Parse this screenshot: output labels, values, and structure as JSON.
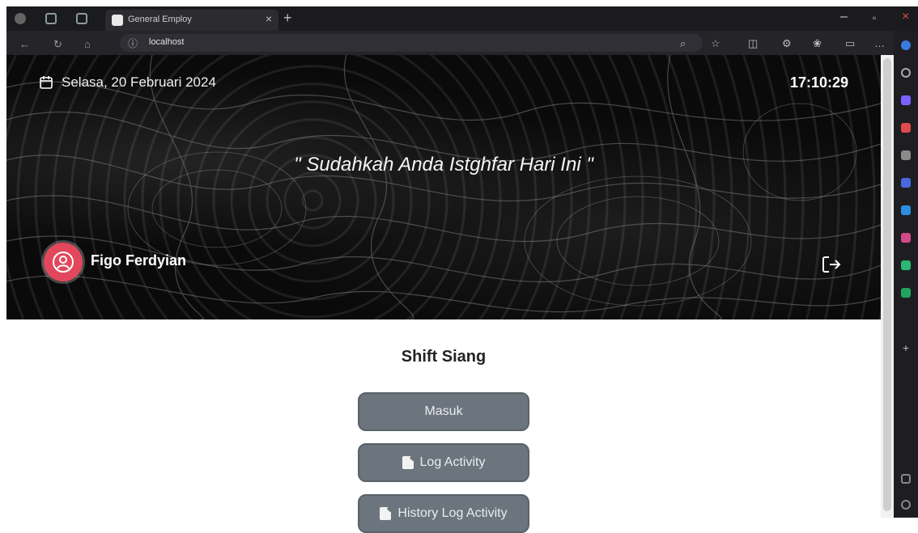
{
  "browser": {
    "tab_title": "General Employ",
    "new_tab_symbol": "+",
    "url": "localhost"
  },
  "hero": {
    "date": "Selasa, 20 Februari 2024",
    "time": "17:10:29",
    "quote": "\" Sudahkah Anda Istghfar Hari Ini \"",
    "user": {
      "name": "Figo Ferdyian"
    }
  },
  "main": {
    "shift_title": "Shift Siang",
    "buttons": [
      {
        "label": "Masuk"
      },
      {
        "label": "Log Activity"
      },
      {
        "label": "History Log Activity"
      }
    ]
  },
  "colors": {
    "button_bg": "#6c757d",
    "avatar_bg": "#e2475b",
    "hero_bg": "#0c0c0c"
  },
  "icons": [
    "calendar-icon",
    "user-circle-icon",
    "logout-icon",
    "file-icon"
  ]
}
